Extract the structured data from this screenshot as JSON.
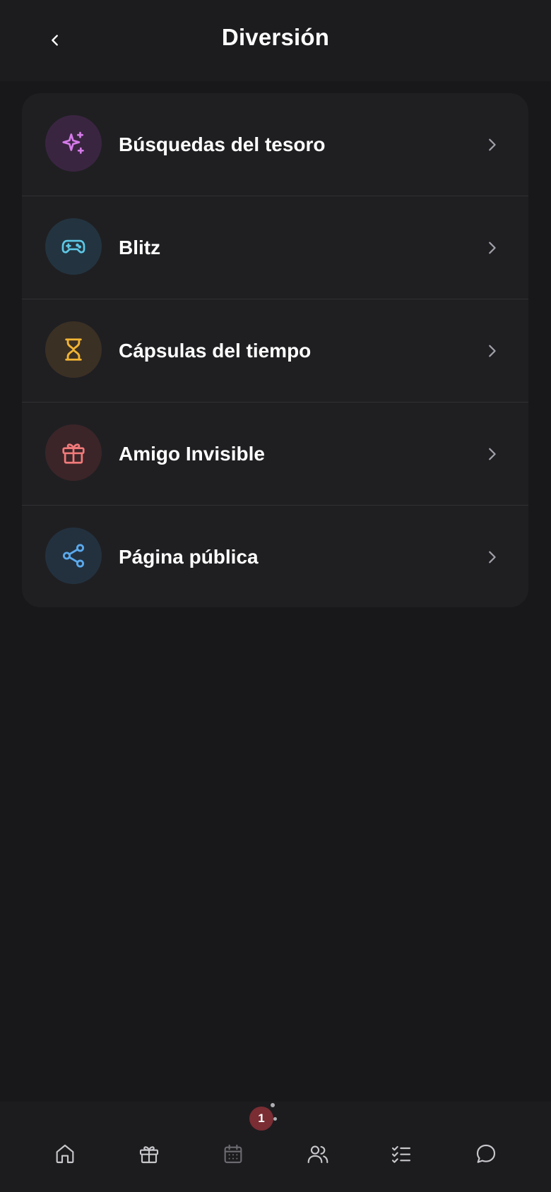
{
  "header": {
    "title": "Diversión"
  },
  "menu": {
    "items": [
      {
        "label": "Búsquedas del tesoro",
        "icon": "sparkles-icon",
        "accent": "#d47ae8",
        "bg": "#3a2541"
      },
      {
        "label": "Blitz",
        "icon": "gamepad-icon",
        "accent": "#5ec8e6",
        "bg": "#233440"
      },
      {
        "label": "Cápsulas del tiempo",
        "icon": "hourglass-icon",
        "accent": "#f2b534",
        "bg": "#3b3024"
      },
      {
        "label": "Amigo Invisible",
        "icon": "gift-icon",
        "accent": "#f27a7a",
        "bg": "#3b2528"
      },
      {
        "label": "Página pública",
        "icon": "share-icon",
        "accent": "#5aa9ec",
        "bg": "#23313f"
      }
    ]
  },
  "bottom_nav": {
    "items": [
      {
        "icon": "home-icon"
      },
      {
        "icon": "gift-icon"
      },
      {
        "icon": "calendar-icon"
      },
      {
        "icon": "users-icon"
      },
      {
        "icon": "checklist-icon"
      },
      {
        "icon": "chat-icon"
      }
    ],
    "badge_count": "1"
  },
  "colors": {
    "background": "#18181b",
    "card": "#1f1f22",
    "nav_icon": "#c8c8cc",
    "badge": "#7a2d33"
  }
}
